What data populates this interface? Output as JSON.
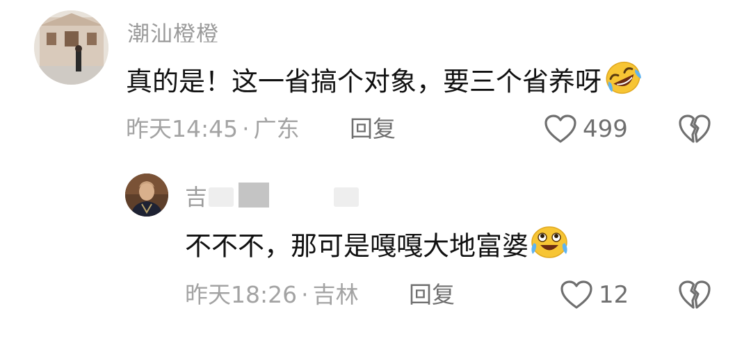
{
  "comments": [
    {
      "username": "潮汕橙橙",
      "message": "真的是！这一省搞个对象，要三个省养呀",
      "emoji": "rolling-laughing-emoji",
      "time": "昨天14:45",
      "separator": "·",
      "location": "广东",
      "reply_label": "回复",
      "likes": "499",
      "avatar": "avatar-photo-building"
    },
    {
      "username": "吉",
      "message": "不不不，那可是嘎嘎大地富婆",
      "emoji": "tears-of-joy-emoji",
      "time": "昨天18:26",
      "separator": "·",
      "location": "吉林",
      "reply_label": "回复",
      "likes": "12",
      "avatar": "avatar-photo-man"
    }
  ],
  "colors": {
    "meta_text": "#a3a3a3",
    "icon_stroke": "#6f6f6f",
    "emoji_yellow": "#f7c534"
  }
}
